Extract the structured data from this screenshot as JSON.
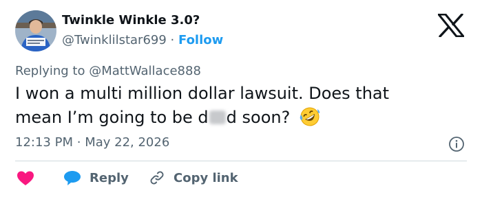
{
  "author": {
    "name": "Twinkle Winkle 3.0?",
    "handle": "@Twinklilstar699",
    "separator": "·",
    "follow_label": "Follow"
  },
  "reply_to": {
    "prefix": "Replying to ",
    "mention": "@MattWallace888"
  },
  "tweet": {
    "line1": "I won a multi million dollar lawsuit. Does that",
    "line2_before": "mean I’m going to be d",
    "line2_after": "d soon?",
    "emoji_icon": "rolling-on-floor-laughing-emoji"
  },
  "meta": {
    "time": "12:13 PM",
    "separator": "·",
    "date": "May 22, 2026",
    "info_icon": "info-icon"
  },
  "actions": {
    "like_icon": "heart-icon",
    "reply_label": "Reply",
    "reply_icon": "speech-bubble-icon",
    "copy_link_label": "Copy link",
    "copy_link_icon": "link-icon"
  },
  "brand": {
    "logo_icon": "x-logo-icon"
  },
  "colors": {
    "accent": "#1d9bf0",
    "like": "#f91880",
    "text": "#0f1419",
    "muted": "#536471",
    "divider": "#cfd9de"
  }
}
